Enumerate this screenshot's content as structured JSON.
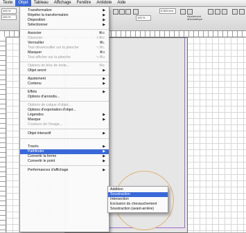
{
  "menubar": {
    "items": [
      "Texte",
      "Objet",
      "Tableau",
      "Affichage",
      "Fenêtre",
      "Antidote",
      "Aide"
    ],
    "active": "Objet"
  },
  "toolbar": {
    "zoom_1": "100 %",
    "zoom_2": "100 %",
    "stroke_weight": "0,353 mm",
    "pct": "100 %",
    "doc_tab": "*2.indd @ 125%",
    "auto_fit": "Ajustement automatique"
  },
  "menu": {
    "items": [
      {
        "label": "Transformation",
        "arrow": "▶"
      },
      {
        "label": "Répéter la transformation",
        "arrow": "▶"
      },
      {
        "label": "Disposition",
        "arrow": "▶"
      },
      {
        "label": "Sélectionner",
        "arrow": "▶"
      },
      {
        "label": "Associer",
        "shortcut": "⌘G"
      },
      {
        "label": "Dissocier",
        "shortcut": "⇧⌘G",
        "disabled": true
      },
      {
        "label": "Verrouiller",
        "shortcut": "⌘L"
      },
      {
        "label": "Tout déverrouiller sur la planche",
        "shortcut": "⌥⌘L",
        "disabled": true
      },
      {
        "label": "Masquer",
        "shortcut": "⌘3"
      },
      {
        "label": "Tout afficher sur la planche",
        "shortcut": "⌥⌘3",
        "disabled": true
      },
      {
        "label": "Options de bloc de texte...",
        "shortcut": "⌘B",
        "disabled": true
      },
      {
        "label": "Objet ancré",
        "arrow": "▶"
      },
      {
        "label": "Ajustement",
        "arrow": "▶"
      },
      {
        "label": "Contenu",
        "arrow": "▶"
      },
      {
        "label": "Effets",
        "arrow": "▶"
      },
      {
        "label": "Options d'arrondis..."
      },
      {
        "label": "Options de calque d'objet...",
        "disabled": true
      },
      {
        "label": "Options d'exportation d'objet..."
      },
      {
        "label": "Légendes",
        "arrow": "▶"
      },
      {
        "label": "Masque",
        "arrow": "▶"
      },
      {
        "label": "Couleurs de l'image...",
        "disabled": true
      },
      {
        "label": "Objet interactif",
        "arrow": "▶"
      },
      {
        "label": "Tracés",
        "arrow": "▶"
      },
      {
        "label": "Pathfinder",
        "arrow": "▶",
        "highlighted": true
      },
      {
        "label": "Convertir la forme",
        "arrow": "▶"
      },
      {
        "label": "Convertir le point",
        "arrow": "▶"
      },
      {
        "label": "Performances d'affichage",
        "arrow": "▶"
      }
    ]
  },
  "submenu": {
    "items": [
      {
        "label": "Addition"
      },
      {
        "label": "Soustraction",
        "highlighted": true
      },
      {
        "label": "Intersection"
      },
      {
        "label": "Exclusion du chevauchement"
      },
      {
        "label": "Soustraction (avant-arrière)"
      }
    ]
  },
  "colors": {
    "highlight": "#3a68d8",
    "margin_guide": "#a06ad0",
    "circle_stroke": "#e0b070"
  }
}
